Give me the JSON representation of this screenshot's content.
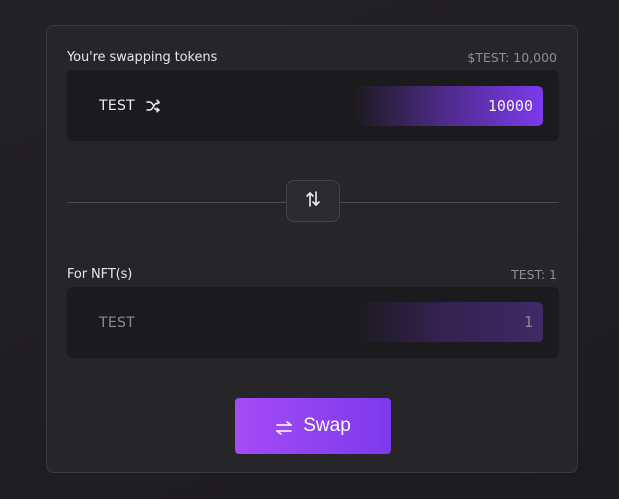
{
  "from": {
    "label": "You're swapping tokens",
    "balance": "$TEST: 10,000",
    "token": "TEST",
    "amount": "10000",
    "icon": "shuffle-icon"
  },
  "switch": {
    "icon": "swap-vertical-arrows-icon"
  },
  "to": {
    "label": "For NFT(s)",
    "balance": "TEST: 1",
    "token": "TEST",
    "amount": "1"
  },
  "action": {
    "label": "Swap",
    "icon": "swap-horizontal-arrows-icon"
  },
  "colors": {
    "accent": "#7c3aed",
    "accent_light": "#a54bf5",
    "card_bg": "#262528",
    "box_bg": "#1b1a1d"
  }
}
